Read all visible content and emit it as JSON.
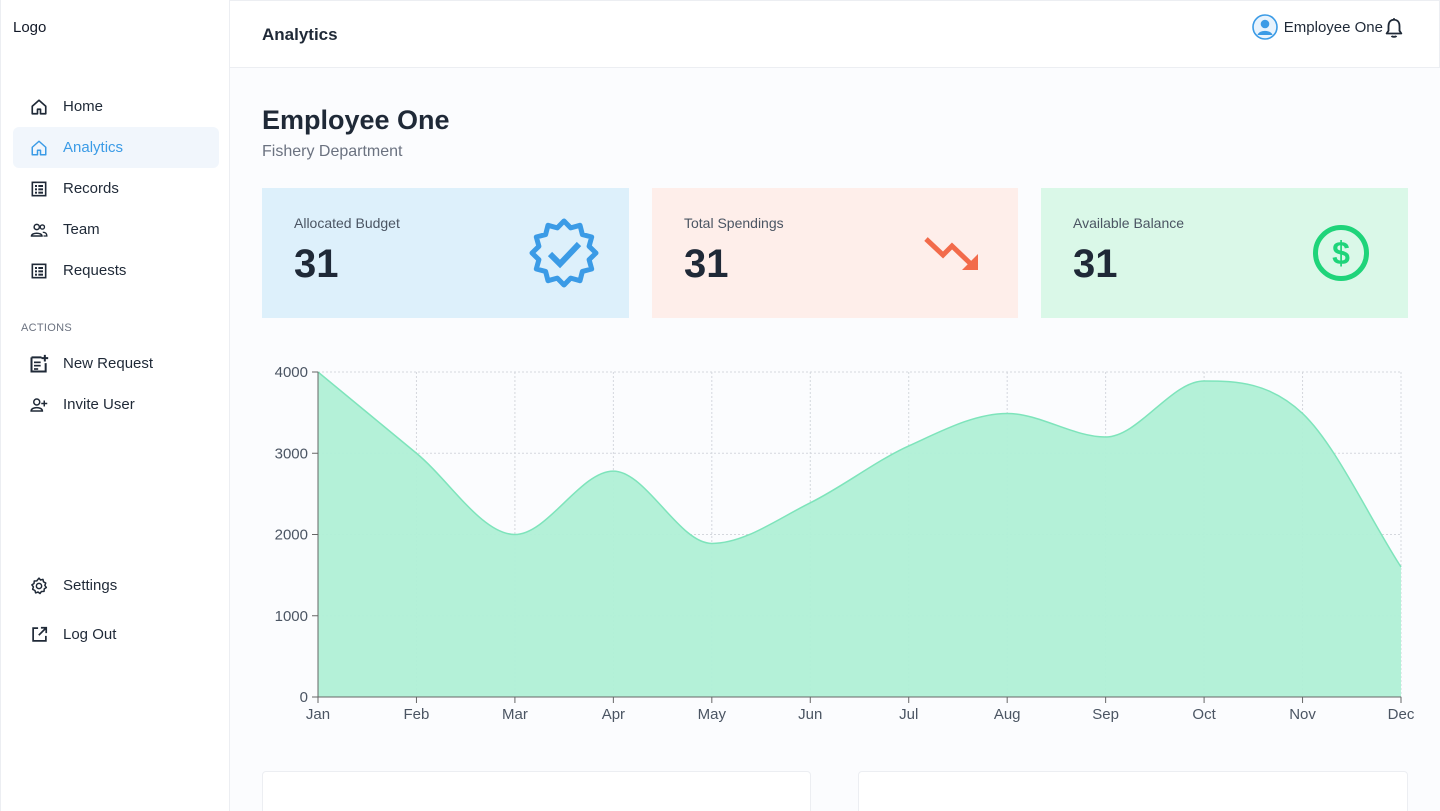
{
  "sidebar": {
    "logo": "Logo",
    "items": [
      {
        "label": "Home",
        "icon": "home-icon"
      },
      {
        "label": "Analytics",
        "icon": "home-outline-icon",
        "active": true
      },
      {
        "label": "Records",
        "icon": "list-icon"
      },
      {
        "label": "Team",
        "icon": "people-icon"
      },
      {
        "label": "Requests",
        "icon": "list-icon"
      }
    ],
    "actions_label": "ACTIONS",
    "actions": [
      {
        "label": "New Request",
        "icon": "note-add-icon"
      },
      {
        "label": "Invite User",
        "icon": "person-add-icon"
      }
    ],
    "footer": [
      {
        "label": "Settings",
        "icon": "gear-icon"
      },
      {
        "label": "Log Out",
        "icon": "external-link-icon"
      }
    ]
  },
  "header": {
    "title": "Analytics",
    "user_name": "Employee One"
  },
  "main": {
    "title": "Employee One",
    "subtitle": "Fishery Department",
    "cards": [
      {
        "label": "Allocated Budget",
        "value": "31",
        "icon": "verified-badge-icon",
        "color": "#3b9be6"
      },
      {
        "label": "Total Spendings",
        "value": "31",
        "icon": "trending-down-icon",
        "color": "#f26b4b"
      },
      {
        "label": "Available Balance",
        "value": "31",
        "icon": "dollar-circle-icon",
        "color": "#1fd47a"
      }
    ]
  },
  "colors": {
    "accent": "#3b9be6",
    "area_fill": "#b0f0d6",
    "area_stroke": "#7ee4bb"
  },
  "chart_data": {
    "type": "area",
    "categories": [
      "Jan",
      "Feb",
      "Mar",
      "Apr",
      "May",
      "Jun",
      "Jul",
      "Aug",
      "Sep",
      "Oct",
      "Nov",
      "Dec"
    ],
    "values": [
      4000,
      3000,
      2000,
      2780,
      1890,
      2390,
      3090,
      3490,
      3200,
      3890,
      3490,
      1600
    ],
    "ylim": [
      0,
      4000
    ],
    "yticks": [
      0,
      1000,
      2000,
      3000,
      4000
    ],
    "grid": true
  }
}
